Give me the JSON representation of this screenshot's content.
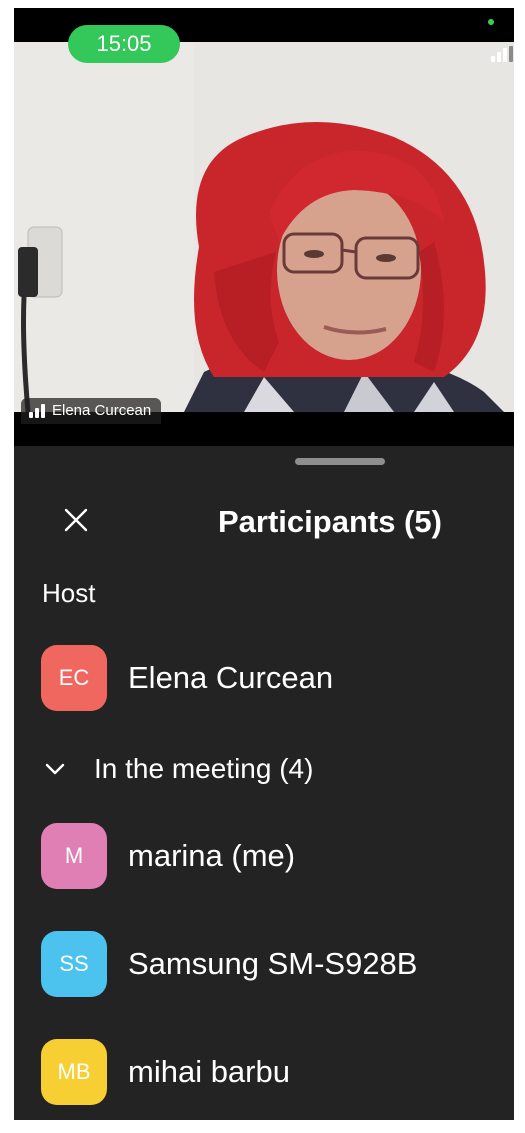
{
  "status_bar": {
    "time": "15:05"
  },
  "video": {
    "speaker_name": "Elena Curcean"
  },
  "participants_panel": {
    "title": "Participants (5)",
    "host_section_label": "Host",
    "host": {
      "initials": "EC",
      "name": "Elena Curcean",
      "avatar_color": "#f0675f"
    },
    "meeting_section_label": "In the meeting (4)",
    "attendees": [
      {
        "initials": "M",
        "name": "marina (me)",
        "avatar_color": "#e07fb4"
      },
      {
        "initials": "SS",
        "name": "Samsung SM-S928B",
        "avatar_color": "#4cc3ee"
      },
      {
        "initials": "MB",
        "name": "mihai barbu",
        "avatar_color": "#f7cf32"
      }
    ]
  },
  "icons": {
    "close": "close-icon",
    "chevron": "chevron-down-icon",
    "signal": "signal-bars-icon"
  },
  "colors": {
    "clock_pill": "#34c759",
    "sheet_background": "#232323"
  }
}
